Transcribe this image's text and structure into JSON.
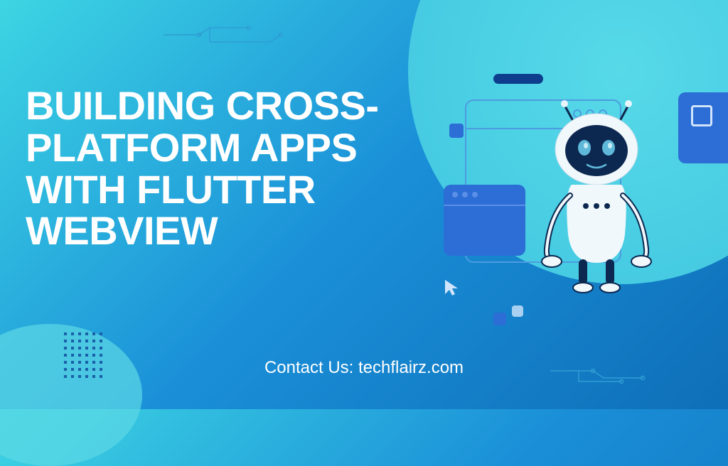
{
  "headline": "BUILDING CROSS-PLATFORM APPS WITH FLUTTER WEBVIEW",
  "contact": "Contact Us: techflairz.com",
  "colors": {
    "bg_gradient_start": "#3dd5e3",
    "bg_gradient_end": "#0e6fb8",
    "accent_blue": "#2c6dd6",
    "dark_blue": "#0d3d8c",
    "text": "#ffffff"
  },
  "illustration": {
    "elements": [
      "robot",
      "window-back",
      "window-front",
      "panel-right",
      "cursor",
      "bar",
      "squares"
    ]
  }
}
